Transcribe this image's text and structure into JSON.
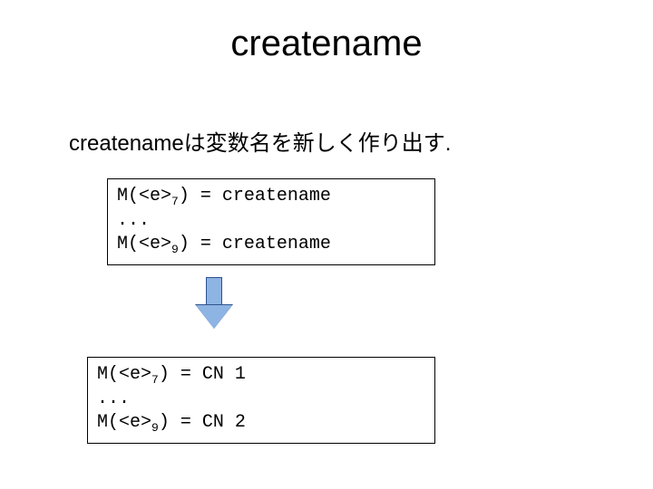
{
  "title": "createname",
  "sentence": "createnameは変数名を新しく作り出す.",
  "box1": {
    "line1": {
      "fn": "M(<e>",
      "sub": "7",
      "rest": ") = createname"
    },
    "line2": "...",
    "line3": {
      "fn": "M(<e>",
      "sub": "9",
      "rest": ") = createname"
    }
  },
  "box2": {
    "line1": {
      "fn": "M(<e>",
      "sub": "7",
      "rest": ") = CN 1"
    },
    "line2": "...",
    "line3": {
      "fn": "M(<e>",
      "sub": "9",
      "rest": ") = CN 2"
    }
  }
}
